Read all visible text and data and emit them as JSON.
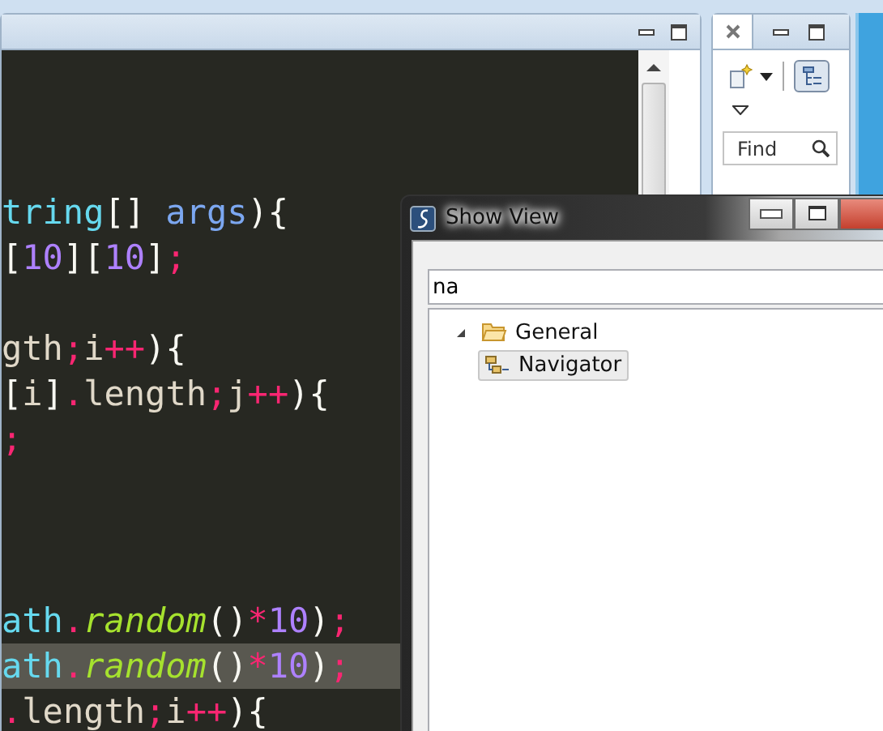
{
  "editor": {
    "lines": [
      {
        "kind": "blank"
      },
      {
        "kind": "blank"
      },
      {
        "kind": "blank"
      },
      {
        "kind": "code",
        "highlighted": false,
        "tokens": [
          {
            "text": "tring",
            "kind": "type"
          },
          {
            "text": "[] ",
            "kind": "punct"
          },
          {
            "text": "args",
            "kind": "param"
          },
          {
            "text": "){",
            "kind": "punct"
          }
        ]
      },
      {
        "kind": "code",
        "highlighted": false,
        "tokens": [
          {
            "text": "[",
            "kind": "punct"
          },
          {
            "text": "10",
            "kind": "number"
          },
          {
            "text": "][",
            "kind": "punct"
          },
          {
            "text": "10",
            "kind": "number"
          },
          {
            "text": "]",
            "kind": "punct"
          },
          {
            "text": ";",
            "kind": "operator"
          }
        ]
      },
      {
        "kind": "blank"
      },
      {
        "kind": "code",
        "highlighted": false,
        "tokens": [
          {
            "text": "gth",
            "kind": "ident"
          },
          {
            "text": ";",
            "kind": "operator"
          },
          {
            "text": "i",
            "kind": "ident"
          },
          {
            "text": "++",
            "kind": "operator"
          },
          {
            "text": "){",
            "kind": "punct"
          }
        ]
      },
      {
        "kind": "code",
        "highlighted": false,
        "tokens": [
          {
            "text": "[",
            "kind": "punct"
          },
          {
            "text": "i",
            "kind": "ident"
          },
          {
            "text": "]",
            "kind": "punct"
          },
          {
            "text": ".",
            "kind": "operator"
          },
          {
            "text": "length",
            "kind": "ident"
          },
          {
            "text": ";",
            "kind": "operator"
          },
          {
            "text": "j",
            "kind": "ident"
          },
          {
            "text": "++",
            "kind": "operator"
          },
          {
            "text": "){",
            "kind": "punct"
          }
        ]
      },
      {
        "kind": "code",
        "highlighted": false,
        "tokens": [
          {
            "text": ";",
            "kind": "operator"
          }
        ]
      },
      {
        "kind": "blank"
      },
      {
        "kind": "blank"
      },
      {
        "kind": "blank"
      },
      {
        "kind": "code",
        "highlighted": false,
        "tokens": [
          {
            "text": "ath",
            "kind": "type"
          },
          {
            "text": ".",
            "kind": "operator"
          },
          {
            "text": "random",
            "kind": "method"
          },
          {
            "text": "()",
            "kind": "punct"
          },
          {
            "text": "*",
            "kind": "operator"
          },
          {
            "text": "10",
            "kind": "number"
          },
          {
            "text": ")",
            "kind": "punct"
          },
          {
            "text": ";",
            "kind": "operator"
          }
        ]
      },
      {
        "kind": "code",
        "highlighted": true,
        "tokens": [
          {
            "text": "ath",
            "kind": "type"
          },
          {
            "text": ".",
            "kind": "operator"
          },
          {
            "text": "random",
            "kind": "method"
          },
          {
            "text": "()",
            "kind": "punct"
          },
          {
            "text": "*",
            "kind": "operator"
          },
          {
            "text": "10",
            "kind": "number"
          },
          {
            "text": ")",
            "kind": "punct"
          },
          {
            "text": ";",
            "kind": "operator"
          }
        ]
      },
      {
        "kind": "code",
        "highlighted": false,
        "tokens": [
          {
            "text": ".",
            "kind": "operator"
          },
          {
            "text": "length",
            "kind": "ident"
          },
          {
            "text": ";",
            "kind": "operator"
          },
          {
            "text": "i",
            "kind": "ident"
          },
          {
            "text": "++",
            "kind": "operator"
          },
          {
            "text": "){",
            "kind": "punct"
          }
        ]
      }
    ]
  },
  "side_panel": {
    "search": {
      "placeholder": "Find"
    }
  },
  "dialog": {
    "title": "Show View",
    "filter": {
      "value": "na"
    },
    "tree": [
      {
        "label": "General",
        "expanded": true,
        "selected": false,
        "children": [
          {
            "label": "Navigator",
            "selected": true
          }
        ]
      }
    ]
  }
}
